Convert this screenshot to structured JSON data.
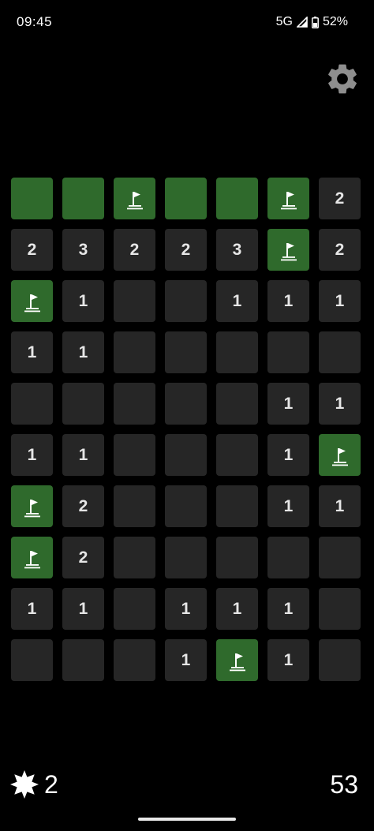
{
  "status_bar": {
    "time": "09:45",
    "network": "5G",
    "battery": "52%"
  },
  "settings": {
    "icon": "gear-icon"
  },
  "board": {
    "columns": 7,
    "rows": 10,
    "cells": [
      [
        "hidden",
        "hidden",
        "flag",
        "hidden",
        "hidden",
        "flag",
        "2"
      ],
      [
        "2",
        "3",
        "2",
        "2",
        "3",
        "flag",
        "2"
      ],
      [
        "flag",
        "1",
        "",
        "",
        "1",
        "1",
        "1"
      ],
      [
        "1",
        "1",
        "",
        "",
        "",
        "",
        ""
      ],
      [
        "",
        "",
        "",
        "",
        "",
        "1",
        "1"
      ],
      [
        "1",
        "1",
        "",
        "",
        "",
        "1",
        "flag"
      ],
      [
        "flag",
        "2",
        "",
        "",
        "",
        "1",
        "1"
      ],
      [
        "flag",
        "2",
        "",
        "",
        "",
        "",
        ""
      ],
      [
        "1",
        "1",
        "",
        "1",
        "1",
        "1",
        ""
      ],
      [
        "",
        "",
        "",
        "1",
        "flag",
        "1",
        ""
      ]
    ]
  },
  "footer": {
    "mines_remaining": "2",
    "timer": "53",
    "mine_icon": "mine-icon"
  },
  "colors": {
    "hidden_tile": "#2f6a2c",
    "revealed_tile": "#262626",
    "background": "#000000",
    "number_text": "#e6e6e6"
  }
}
